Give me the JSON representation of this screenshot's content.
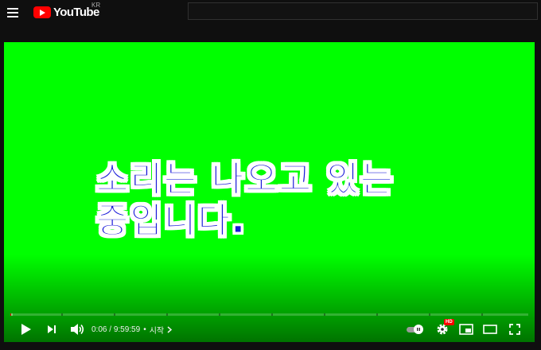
{
  "header": {
    "menu_icon": "hamburger-menu-icon",
    "logo_text": "YouTube",
    "country_code": "KR",
    "search_placeholder": ""
  },
  "video": {
    "caption_lines": [
      "소리는 나오고 있는",
      "중입니다."
    ],
    "background_color": "#00ff00",
    "caption_color": "#1a19d9",
    "caption_outline_color": "#ffffff",
    "progress": {
      "played_fraction": 0.0002,
      "loaded_fraction": 0.004
    }
  },
  "controls": {
    "current_time": "0:06",
    "separator": "/",
    "duration": "9:59:59",
    "bullet": "•",
    "chapter_label": "시작",
    "icons": {
      "play": "play-icon",
      "next": "next-icon",
      "volume": "volume-icon",
      "chapter_arrow": "chevron-right-icon",
      "autoplay": "autoplay-toggle-icon",
      "settings": "gear-icon",
      "settings_badge": "HD",
      "miniplayer": "miniplayer-icon",
      "theater": "theater-mode-icon",
      "fullscreen": "fullscreen-icon"
    }
  },
  "colors": {
    "page_bg": "#0f0f0f",
    "accent": "#ff0000"
  }
}
